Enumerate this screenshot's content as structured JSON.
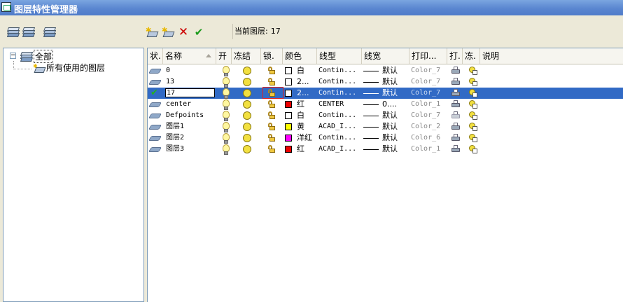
{
  "window": {
    "title": "图层特性管理器"
  },
  "toolbar": {
    "left_buttons": [
      "layer-states-icon",
      "layer-filter-icon",
      "layer-properties-icon"
    ],
    "right_buttons": [
      "new-layer-icon",
      "new-layer-frozen-vp-icon",
      "delete-layer-icon",
      "set-current-icon"
    ],
    "current_layer_caption": "当前图层:",
    "current_layer_value": "17"
  },
  "tree": {
    "toggle": "−",
    "root": "全部",
    "child": "所有使用的图层"
  },
  "columns": {
    "status": "状.",
    "name": "名称",
    "on": "开",
    "freeze": "冻结",
    "lock": "锁.",
    "color": "颜色",
    "linetype": "线型",
    "lineweight": "线宽",
    "plot_style": "打印...",
    "plot": "打.",
    "vp_freeze": "冻.",
    "description": "说明"
  },
  "colors": {
    "selected_row": "#316ac5",
    "accent_red": "#e02020"
  },
  "layers": [
    {
      "status": "layer",
      "name": "0",
      "color_hex": "#ffffff",
      "color_name": "白",
      "linetype": "Contin...",
      "lineweight": "默认",
      "plot_style": "Color_7",
      "plot": true,
      "selected": false
    },
    {
      "status": "layer",
      "name": "13",
      "color_hex": "#ffffff",
      "color_name": "2...",
      "linetype": "Contin...",
      "lineweight": "默认",
      "plot_style": "Color_7",
      "plot": true,
      "selected": false
    },
    {
      "status": "current",
      "name": "17",
      "color_hex": "#ffffff",
      "color_name": "2...",
      "linetype": "Contin...",
      "lineweight": "默认",
      "plot_style": "Color_7",
      "plot": true,
      "selected": true
    },
    {
      "status": "layer",
      "name": "center",
      "color_hex": "#ee0000",
      "color_name": "红",
      "linetype": "CENTER",
      "lineweight": "0....",
      "plot_style": "Color_1",
      "plot": true,
      "selected": false
    },
    {
      "status": "layer",
      "name": "Defpoints",
      "color_hex": "#ffffff",
      "color_name": "白",
      "linetype": "Contin...",
      "lineweight": "默认",
      "plot_style": "Color_7",
      "plot": false,
      "selected": false
    },
    {
      "status": "layer",
      "name": "图层1",
      "color_hex": "#ffff00",
      "color_name": "黄",
      "linetype": "ACAD_I...",
      "lineweight": "默认",
      "plot_style": "Color_2",
      "plot": true,
      "selected": false
    },
    {
      "status": "layer",
      "name": "图层2",
      "color_hex": "#ff00ff",
      "color_name": "洋红",
      "linetype": "Contin...",
      "lineweight": "默认",
      "plot_style": "Color_6",
      "plot": true,
      "selected": false
    },
    {
      "status": "layer",
      "name": "图层3",
      "color_hex": "#ee0000",
      "color_name": "红",
      "linetype": "ACAD_I...",
      "lineweight": "默认",
      "plot_style": "Color_1",
      "plot": true,
      "selected": false
    }
  ]
}
